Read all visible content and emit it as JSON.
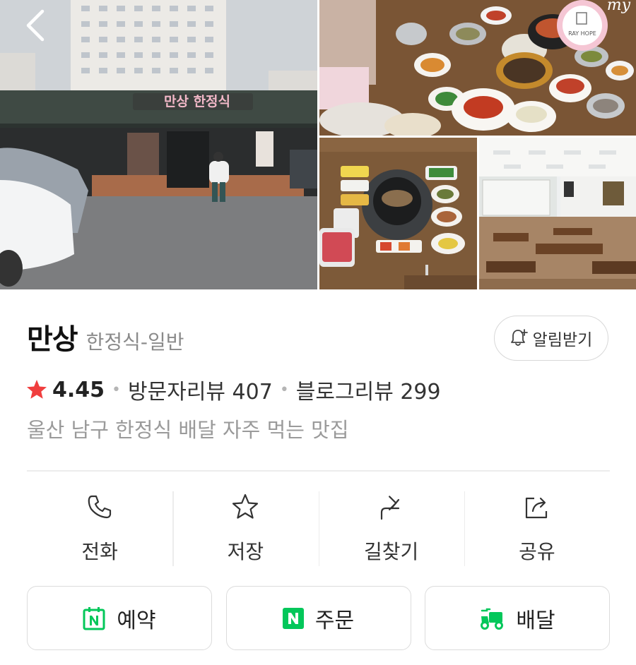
{
  "header": {
    "back_icon": "chevron-left-icon"
  },
  "photos": [
    {
      "name": "storefront-photo",
      "signboard": "만상 한정식"
    },
    {
      "name": "table-dishes-photo",
      "watermark_top": "my",
      "watermark_brand": "RAY HOPE"
    },
    {
      "name": "grill-set-photo"
    },
    {
      "name": "dining-room-photo"
    }
  ],
  "place": {
    "name": "만상",
    "category": "한정식-일반",
    "rating": "4.45",
    "visitor_reviews": "방문자리뷰 407",
    "blog_reviews": "블로그리뷰 299",
    "description": "울산 남구 한정식 배달 자주 먹는 맛집"
  },
  "alarm": {
    "label": "알림받기",
    "icon": "bell-plus-icon"
  },
  "actions": [
    {
      "label": "전화",
      "icon": "phone-icon"
    },
    {
      "label": "저장",
      "icon": "star-outline-icon"
    },
    {
      "label": "길찾기",
      "icon": "route-arrow-icon"
    },
    {
      "label": "공유",
      "icon": "share-icon"
    }
  ],
  "buttons": [
    {
      "label": "예약",
      "icon": "naver-calendar-icon"
    },
    {
      "label": "주문",
      "icon": "naver-n-icon"
    },
    {
      "label": "배달",
      "icon": "delivery-scooter-icon"
    }
  ],
  "colors": {
    "naver_green": "#03c75a",
    "star_red": "#f03e3e",
    "muted_text": "#9a9a9a"
  }
}
